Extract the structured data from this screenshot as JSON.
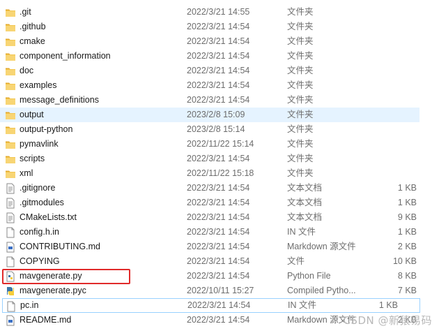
{
  "files": [
    {
      "name": ".git",
      "date": "2022/3/21 14:55",
      "type": "文件夹",
      "size": "",
      "icon": "folder-icon"
    },
    {
      "name": ".github",
      "date": "2022/3/21 14:54",
      "type": "文件夹",
      "size": "",
      "icon": "folder-icon"
    },
    {
      "name": "cmake",
      "date": "2022/3/21 14:54",
      "type": "文件夹",
      "size": "",
      "icon": "folder-icon"
    },
    {
      "name": "component_information",
      "date": "2022/3/21 14:54",
      "type": "文件夹",
      "size": "",
      "icon": "folder-icon"
    },
    {
      "name": "doc",
      "date": "2022/3/21 14:54",
      "type": "文件夹",
      "size": "",
      "icon": "folder-icon"
    },
    {
      "name": "examples",
      "date": "2022/3/21 14:54",
      "type": "文件夹",
      "size": "",
      "icon": "folder-icon"
    },
    {
      "name": "message_definitions",
      "date": "2022/3/21 14:54",
      "type": "文件夹",
      "size": "",
      "icon": "folder-icon"
    },
    {
      "name": "output",
      "date": "2023/2/8 15:09",
      "type": "文件夹",
      "size": "",
      "icon": "folder-icon"
    },
    {
      "name": "output-python",
      "date": "2023/2/8 15:14",
      "type": "文件夹",
      "size": "",
      "icon": "folder-icon"
    },
    {
      "name": "pymavlink",
      "date": "2022/11/22 15:14",
      "type": "文件夹",
      "size": "",
      "icon": "folder-icon"
    },
    {
      "name": "scripts",
      "date": "2022/3/21 14:54",
      "type": "文件夹",
      "size": "",
      "icon": "folder-icon"
    },
    {
      "name": "xml",
      "date": "2022/11/22 15:18",
      "type": "文件夹",
      "size": "",
      "icon": "folder-icon"
    },
    {
      "name": ".gitignore",
      "date": "2022/3/21 14:54",
      "type": "文本文档",
      "size": "1 KB",
      "icon": "text-file-icon"
    },
    {
      "name": ".gitmodules",
      "date": "2022/3/21 14:54",
      "type": "文本文档",
      "size": "1 KB",
      "icon": "text-file-icon"
    },
    {
      "name": "CMakeLists.txt",
      "date": "2022/3/21 14:54",
      "type": "文本文档",
      "size": "9 KB",
      "icon": "text-file-icon"
    },
    {
      "name": "config.h.in",
      "date": "2022/3/21 14:54",
      "type": "IN 文件",
      "size": "1 KB",
      "icon": "blank-file-icon"
    },
    {
      "name": "CONTRIBUTING.md",
      "date": "2022/3/21 14:54",
      "type": "Markdown 源文件",
      "size": "2 KB",
      "icon": "markdown-file-icon"
    },
    {
      "name": "COPYING",
      "date": "2022/3/21 14:54",
      "type": "文件",
      "size": "10 KB",
      "icon": "blank-file-icon"
    },
    {
      "name": "mavgenerate.py",
      "date": "2022/3/21 14:54",
      "type": "Python File",
      "size": "8 KB",
      "icon": "python-file-icon"
    },
    {
      "name": "mavgenerate.pyc",
      "date": "2022/10/11 15:27",
      "type": "Compiled Pytho...",
      "size": "7 KB",
      "icon": "python-compiled-icon"
    },
    {
      "name": "pc.in",
      "date": "2022/3/21 14:54",
      "type": "IN 文件",
      "size": "1 KB",
      "icon": "blank-file-icon"
    },
    {
      "name": "README.md",
      "date": "2022/3/21 14:54",
      "type": "Markdown 源文件",
      "size": "2 KB",
      "icon": "markdown-file-icon"
    }
  ],
  "hovered_file": "output",
  "focused_file": "pc.in",
  "highlighted_file": "mavgenerate.py",
  "watermark": "CSDN @新猿易码",
  "colors": {
    "folder": "#f0c24a",
    "highlight": "#e02a2a",
    "hover": "#e5f3ff",
    "focus_border": "#99d1ff"
  }
}
